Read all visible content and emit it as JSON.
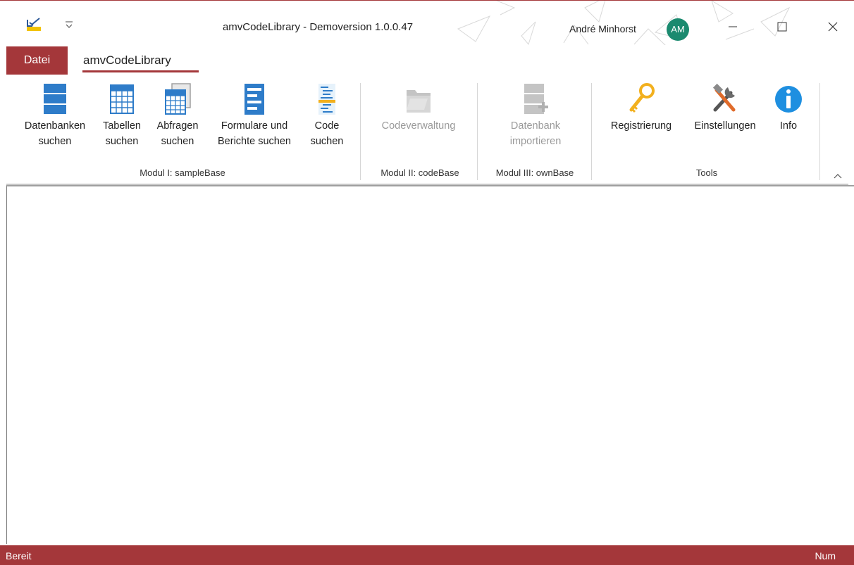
{
  "window": {
    "title": "amvCodeLibrary - Demoversion 1.0.0.47",
    "user_name": "André Minhorst",
    "avatar_initials": "AM",
    "accent": "#a4373a"
  },
  "tabs": {
    "file": "Datei",
    "active": "amvCodeLibrary"
  },
  "ribbon": {
    "buttons": [
      {
        "line1": "Datenbanken",
        "line2": "suchen",
        "icon": "database-icon"
      },
      {
        "line1": "Tabellen",
        "line2": "suchen",
        "icon": "table-icon"
      },
      {
        "line1": "Abfragen",
        "line2": "suchen",
        "icon": "query-icon"
      },
      {
        "line1": "Formulare und",
        "line2": "Berichte suchen",
        "icon": "form-icon"
      },
      {
        "line1": "Code",
        "line2": "suchen",
        "icon": "code-icon"
      },
      {
        "line1": "Codeverwaltung",
        "line2": "",
        "icon": "folder-icon",
        "disabled": true
      },
      {
        "line1": "Datenbank",
        "line2": "importieren",
        "icon": "import-icon",
        "disabled": true
      },
      {
        "line1": "Registrierung",
        "line2": "",
        "icon": "key-icon"
      },
      {
        "line1": "Einstellungen",
        "line2": "",
        "icon": "tools-icon"
      },
      {
        "line1": "Info",
        "line2": "",
        "icon": "info-icon"
      }
    ],
    "groups": [
      "Modul I: sampleBase",
      "Modul II: codeBase",
      "Modul III: ownBase",
      "Tools"
    ]
  },
  "status": {
    "left": "Bereit",
    "right": "Num"
  }
}
